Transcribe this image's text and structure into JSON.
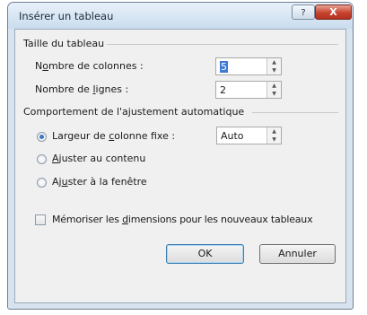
{
  "window": {
    "title": "Insérer un tableau",
    "help_label": "?",
    "close_label": "X"
  },
  "taille": {
    "heading": "Taille du tableau",
    "colonnes_label_pre": "N",
    "colonnes_label_mnem": "o",
    "colonnes_label_post": "mbre de colonnes :",
    "colonnes_value": "5",
    "lignes_label_pre": "Nombre de ",
    "lignes_label_mnem": "l",
    "lignes_label_post": "ignes :",
    "lignes_value": "2"
  },
  "ajustement": {
    "heading": "Comportement de l'ajustement automatique",
    "options": [
      {
        "pre": "Largeur de ",
        "mnem": "c",
        "post": "olonne fixe :",
        "selected": true
      },
      {
        "pre": "",
        "mnem": "A",
        "post": "juster au contenu",
        "selected": false
      },
      {
        "pre": "Aj",
        "mnem": "u",
        "post": "ster à la fenêtre",
        "selected": false
      }
    ],
    "largeur_value": "Auto"
  },
  "memoriser": {
    "pre": "Mémoriser les ",
    "mnem": "d",
    "post": "imensions pour les nouveaux tableaux",
    "checked": false
  },
  "buttons": {
    "ok": "OK",
    "annuler": "Annuler"
  }
}
